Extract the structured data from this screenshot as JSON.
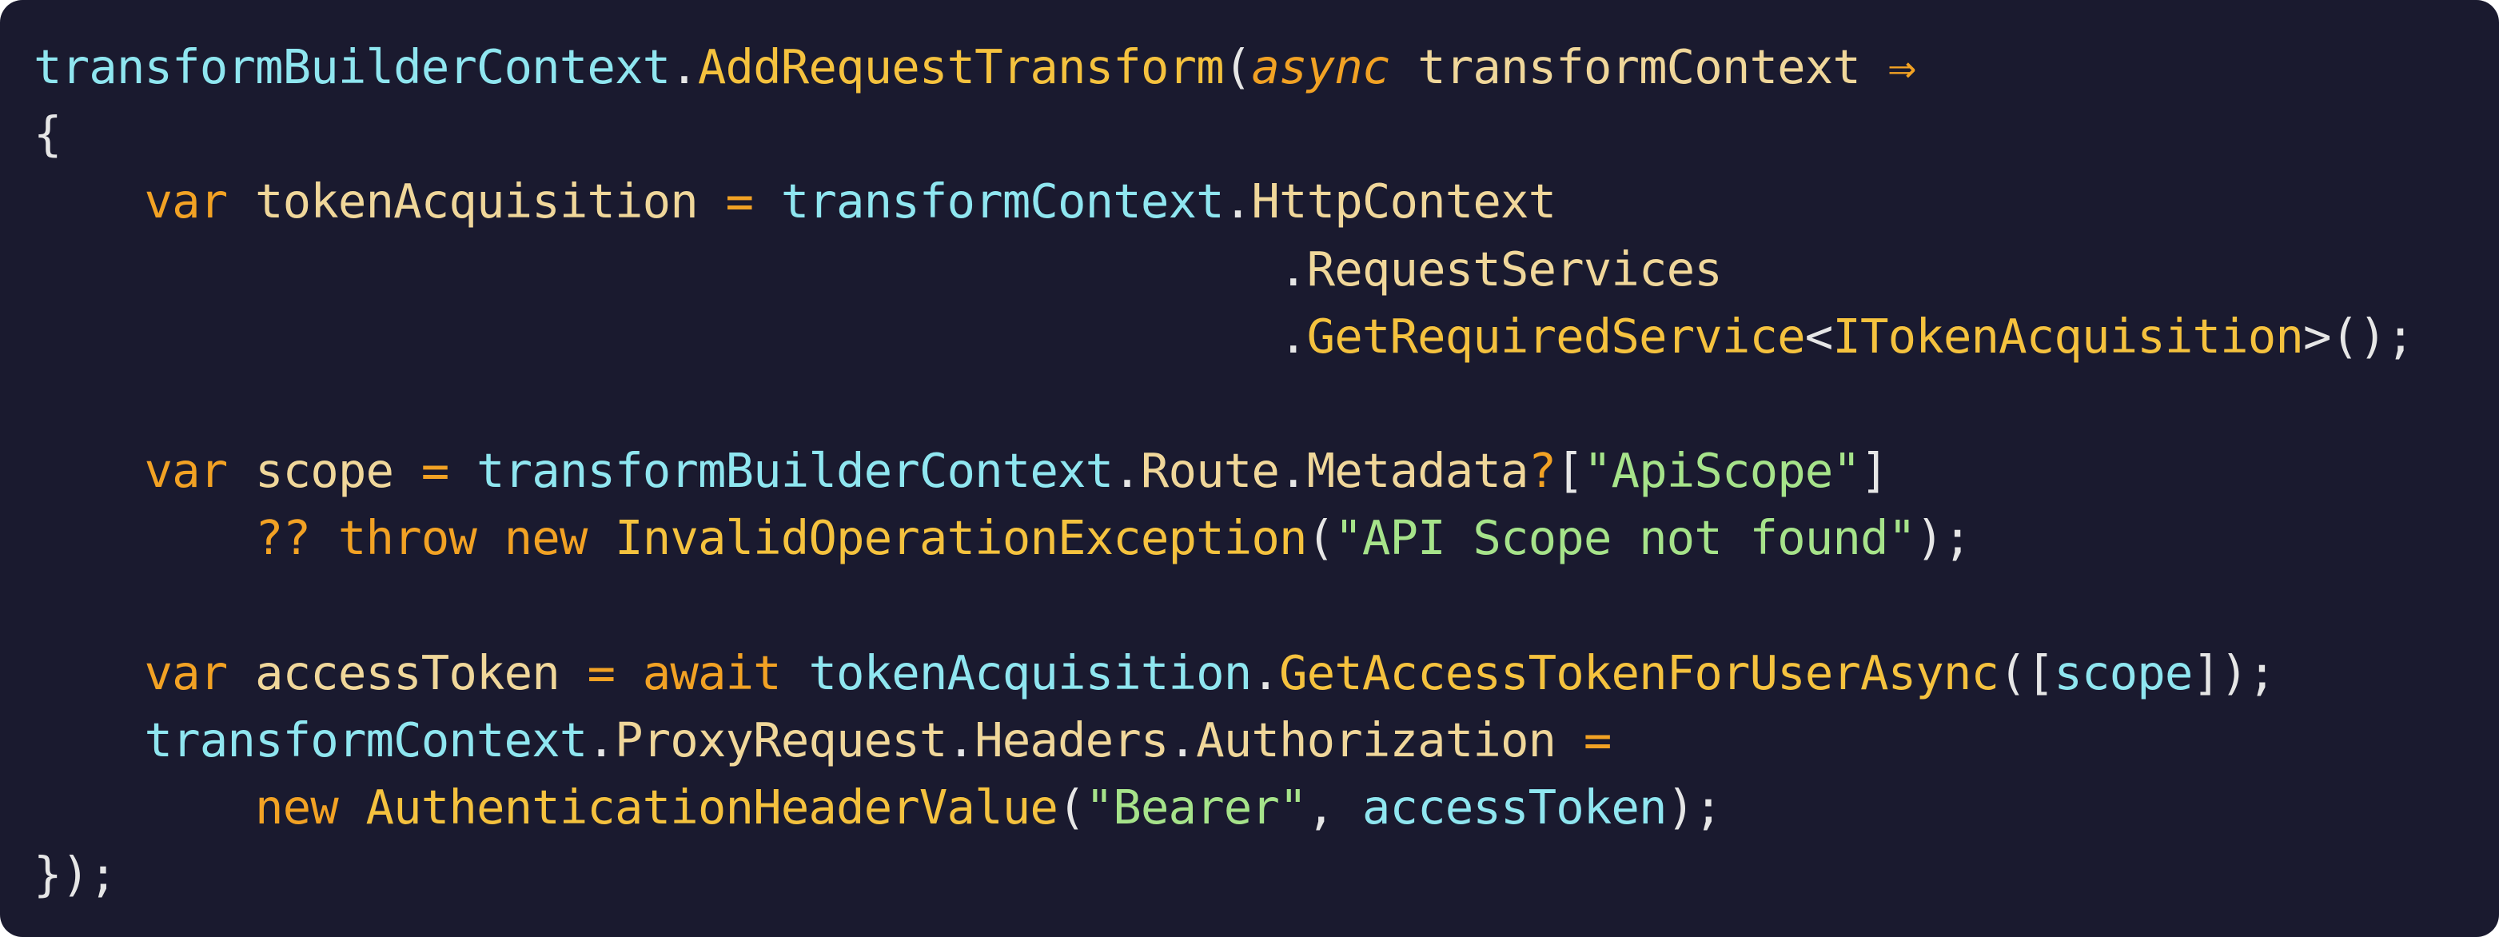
{
  "code_block": {
    "colors": {
      "background": "#1a1a2f",
      "default": "#e6e6e6",
      "ident": "#8fe6f0",
      "method": "#f5c23e",
      "keyword": "#f2a224",
      "string": "#a6e38a",
      "property": "#f0d79a"
    },
    "lines": [
      {
        "tokens": [
          {
            "text": "transformBuilderContext",
            "kind": "ident"
          },
          {
            "text": ".",
            "kind": "punct"
          },
          {
            "text": "AddRequestTransform",
            "kind": "method"
          },
          {
            "text": "(",
            "kind": "punct"
          },
          {
            "text": "async",
            "kind": "keyword-italic"
          },
          {
            "text": " ",
            "kind": "default"
          },
          {
            "text": "transformContext",
            "kind": "property"
          },
          {
            "text": " ",
            "kind": "default"
          },
          {
            "text": "⇒",
            "kind": "keyword"
          }
        ]
      },
      {
        "tokens": [
          {
            "text": "{",
            "kind": "punct"
          }
        ]
      },
      {
        "tokens": [
          {
            "text": "    ",
            "kind": "default"
          },
          {
            "text": "var",
            "kind": "keyword"
          },
          {
            "text": " ",
            "kind": "default"
          },
          {
            "text": "tokenAcquisition",
            "kind": "property"
          },
          {
            "text": " ",
            "kind": "default"
          },
          {
            "text": "=",
            "kind": "keyword"
          },
          {
            "text": " ",
            "kind": "default"
          },
          {
            "text": "transformContext",
            "kind": "ident"
          },
          {
            "text": ".",
            "kind": "punct"
          },
          {
            "text": "HttpContext",
            "kind": "property"
          }
        ]
      },
      {
        "tokens": [
          {
            "text": "                                             ",
            "kind": "default"
          },
          {
            "text": ".",
            "kind": "punct"
          },
          {
            "text": "RequestServices",
            "kind": "property"
          }
        ]
      },
      {
        "tokens": [
          {
            "text": "                                             ",
            "kind": "default"
          },
          {
            "text": ".",
            "kind": "punct"
          },
          {
            "text": "GetRequiredService",
            "kind": "method"
          },
          {
            "text": "<",
            "kind": "punct"
          },
          {
            "text": "ITokenAcquisition",
            "kind": "method"
          },
          {
            "text": ">();",
            "kind": "punct"
          }
        ]
      },
      {
        "tokens": [
          {
            "text": " ",
            "kind": "default"
          }
        ]
      },
      {
        "tokens": [
          {
            "text": "    ",
            "kind": "default"
          },
          {
            "text": "var",
            "kind": "keyword"
          },
          {
            "text": " ",
            "kind": "default"
          },
          {
            "text": "scope",
            "kind": "property"
          },
          {
            "text": " ",
            "kind": "default"
          },
          {
            "text": "=",
            "kind": "keyword"
          },
          {
            "text": " ",
            "kind": "default"
          },
          {
            "text": "transformBuilderContext",
            "kind": "ident"
          },
          {
            "text": ".",
            "kind": "punct"
          },
          {
            "text": "Route",
            "kind": "property"
          },
          {
            "text": ".",
            "kind": "punct"
          },
          {
            "text": "Metadata",
            "kind": "property"
          },
          {
            "text": "?",
            "kind": "keyword"
          },
          {
            "text": "[",
            "kind": "punct"
          },
          {
            "text": "\"ApiScope\"",
            "kind": "string"
          },
          {
            "text": "]",
            "kind": "punct"
          }
        ]
      },
      {
        "tokens": [
          {
            "text": "        ",
            "kind": "default"
          },
          {
            "text": "??",
            "kind": "keyword"
          },
          {
            "text": " ",
            "kind": "default"
          },
          {
            "text": "throw",
            "kind": "keyword"
          },
          {
            "text": " ",
            "kind": "default"
          },
          {
            "text": "new",
            "kind": "keyword"
          },
          {
            "text": " ",
            "kind": "default"
          },
          {
            "text": "InvalidOperationException",
            "kind": "method"
          },
          {
            "text": "(",
            "kind": "punct"
          },
          {
            "text": "\"API Scope not found\"",
            "kind": "string"
          },
          {
            "text": ");",
            "kind": "punct"
          }
        ]
      },
      {
        "tokens": [
          {
            "text": " ",
            "kind": "default"
          }
        ]
      },
      {
        "tokens": [
          {
            "text": "    ",
            "kind": "default"
          },
          {
            "text": "var",
            "kind": "keyword"
          },
          {
            "text": " ",
            "kind": "default"
          },
          {
            "text": "accessToken",
            "kind": "property"
          },
          {
            "text": " ",
            "kind": "default"
          },
          {
            "text": "=",
            "kind": "keyword"
          },
          {
            "text": " ",
            "kind": "default"
          },
          {
            "text": "await",
            "kind": "keyword"
          },
          {
            "text": " ",
            "kind": "default"
          },
          {
            "text": "tokenAcquisition",
            "kind": "ident"
          },
          {
            "text": ".",
            "kind": "punct"
          },
          {
            "text": "GetAccessTokenForUserAsync",
            "kind": "method"
          },
          {
            "text": "([",
            "kind": "punct"
          },
          {
            "text": "scope",
            "kind": "ident"
          },
          {
            "text": "]);",
            "kind": "punct"
          }
        ]
      },
      {
        "tokens": [
          {
            "text": "    ",
            "kind": "default"
          },
          {
            "text": "transformContext",
            "kind": "ident"
          },
          {
            "text": ".",
            "kind": "punct"
          },
          {
            "text": "ProxyRequest",
            "kind": "property"
          },
          {
            "text": ".",
            "kind": "punct"
          },
          {
            "text": "Headers",
            "kind": "property"
          },
          {
            "text": ".",
            "kind": "punct"
          },
          {
            "text": "Authorization",
            "kind": "property"
          },
          {
            "text": " ",
            "kind": "default"
          },
          {
            "text": "=",
            "kind": "keyword"
          }
        ]
      },
      {
        "tokens": [
          {
            "text": "        ",
            "kind": "default"
          },
          {
            "text": "new",
            "kind": "keyword"
          },
          {
            "text": " ",
            "kind": "default"
          },
          {
            "text": "AuthenticationHeaderValue",
            "kind": "method"
          },
          {
            "text": "(",
            "kind": "punct"
          },
          {
            "text": "\"Bearer\"",
            "kind": "string"
          },
          {
            "text": ", ",
            "kind": "punct"
          },
          {
            "text": "accessToken",
            "kind": "ident"
          },
          {
            "text": ");",
            "kind": "punct"
          }
        ]
      },
      {
        "tokens": [
          {
            "text": "});",
            "kind": "punct"
          }
        ]
      }
    ]
  }
}
